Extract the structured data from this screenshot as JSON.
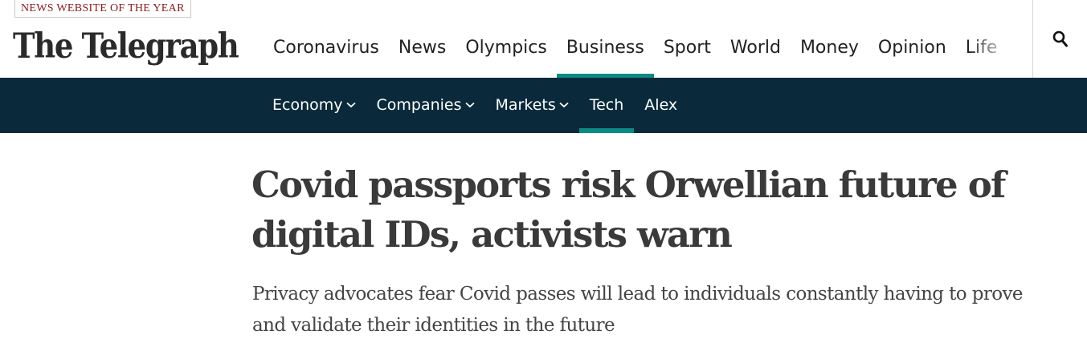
{
  "header": {
    "award": "NEWS WEBSITE OF THE YEAR",
    "logo": "The Telegraph",
    "nav": [
      {
        "label": "Coronavirus"
      },
      {
        "label": "News"
      },
      {
        "label": "Olympics"
      },
      {
        "label": "Business"
      },
      {
        "label": "Sport"
      },
      {
        "label": "World"
      },
      {
        "label": "Money"
      },
      {
        "label": "Opinion"
      },
      {
        "label": "Life"
      }
    ],
    "active_nav": "Business",
    "search_icon": "search-icon"
  },
  "subnav": {
    "items": [
      {
        "label": "Economy",
        "has_dropdown": true
      },
      {
        "label": "Companies",
        "has_dropdown": true
      },
      {
        "label": "Markets",
        "has_dropdown": true
      },
      {
        "label": "Tech",
        "has_dropdown": false
      },
      {
        "label": "Alex",
        "has_dropdown": false
      }
    ],
    "active": "Tech"
  },
  "article": {
    "headline": "Covid passports risk Orwellian future of digital IDs, activists warn",
    "standfirst": "Privacy advocates fear Covid passes will lead to individuals constantly having to prove and validate their identities in the future"
  },
  "colors": {
    "accent": "#0b8b83",
    "subnav_bg": "#0a2a3c",
    "award_text": "#8a1a1a"
  }
}
